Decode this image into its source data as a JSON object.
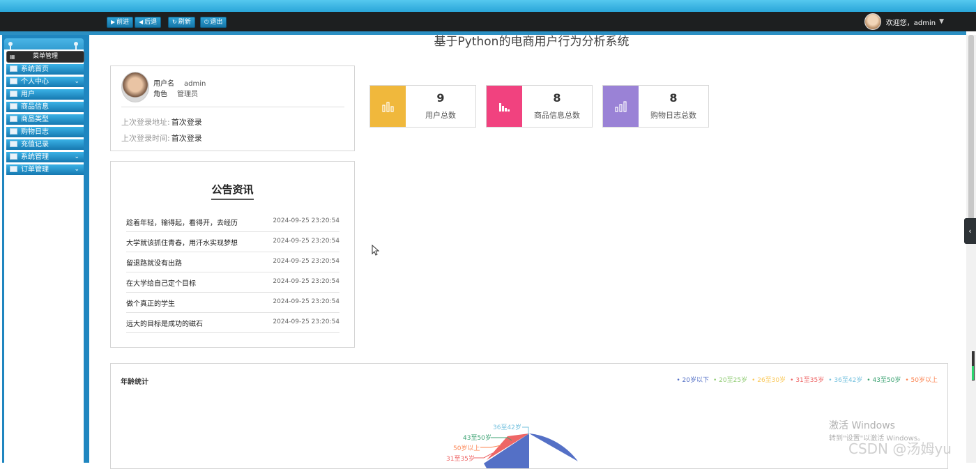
{
  "toolbar": {
    "buttons": [
      {
        "label": "前进",
        "icon": "▶"
      },
      {
        "label": "后退",
        "icon": "◀"
      },
      {
        "label": "刷新",
        "icon": "↻"
      },
      {
        "label": "退出",
        "icon": "⏻"
      }
    ],
    "welcome_text": "欢迎您，admin"
  },
  "sidebar": {
    "title": "菜单管理",
    "items": [
      {
        "label": "系统首页",
        "has_children": false
      },
      {
        "label": "个人中心",
        "has_children": true
      },
      {
        "label": "用户",
        "has_children": false
      },
      {
        "label": "商品信息",
        "has_children": false
      },
      {
        "label": "商品类型",
        "has_children": false
      },
      {
        "label": "购物日志",
        "has_children": false
      },
      {
        "label": "充值记录",
        "has_children": false
      },
      {
        "label": "系统管理",
        "has_children": true
      },
      {
        "label": "订单管理",
        "has_children": true
      }
    ]
  },
  "page_title": "基于Python的电商用户行为分析系统",
  "user_card": {
    "username_label": "用户名",
    "username": "admin",
    "role_label": "角色",
    "role": "管理员",
    "last_login_addr_label": "上次登录地址:",
    "last_login_addr": "首次登录",
    "last_login_time_label": "上次登录时间:",
    "last_login_time": "首次登录"
  },
  "stats": [
    {
      "value": "9",
      "label": "用户总数",
      "color": "#f0b83c"
    },
    {
      "value": "8",
      "label": "商品信息总数",
      "color": "#f1427f"
    },
    {
      "value": "8",
      "label": "购物日志总数",
      "color": "#9a82d6"
    }
  ],
  "news": {
    "title": "公告资讯",
    "items": [
      {
        "title": "趁着年轻，输得起，看得开，去经历",
        "date": "2024-09-25 23:20:54"
      },
      {
        "title": "大学就该抓住青春，用汗水实现梦想",
        "date": "2024-09-25 23:20:54"
      },
      {
        "title": "留退路就没有出路",
        "date": "2024-09-25 23:20:54"
      },
      {
        "title": "在大学给自己定个目标",
        "date": "2024-09-25 23:20:54"
      },
      {
        "title": "做个真正的学生",
        "date": "2024-09-25 23:20:54"
      },
      {
        "title": "远大的目标是成功的磁石",
        "date": "2024-09-25 23:20:54"
      }
    ]
  },
  "chart_data": {
    "type": "pie",
    "title": "年龄统计",
    "legend_position": "top-right",
    "categories": [
      "20岁以下",
      "20至25岁",
      "26至30岁",
      "31至35岁",
      "36至42岁",
      "43至50岁",
      "50岁以上"
    ],
    "colors": [
      "#5470c6",
      "#91cc75",
      "#fac858",
      "#ee6666",
      "#73c0de",
      "#3ba272",
      "#fc8452"
    ],
    "visible_slices": [
      {
        "name": "36至42岁",
        "color": "#5470c6"
      },
      {
        "name": "43至50岁",
        "color": "#ee6666"
      },
      {
        "name": "50岁以上",
        "color": "#ee6666"
      },
      {
        "name": "31至35岁",
        "color": "#5470c6"
      }
    ],
    "slice_labels": [
      {
        "text": "36至42岁",
        "color": "#73c0de"
      },
      {
        "text": "43至50岁",
        "color": "#3ba272"
      },
      {
        "text": "50岁以上",
        "color": "#fc8452"
      },
      {
        "text": "31至35岁",
        "color": "#ee6666"
      }
    ]
  },
  "watermark": {
    "activate_line1": "激活 Windows",
    "activate_line2": "转到\"设置\"以激活 Windows。",
    "csdn": "CSDN @汤姆yu"
  }
}
